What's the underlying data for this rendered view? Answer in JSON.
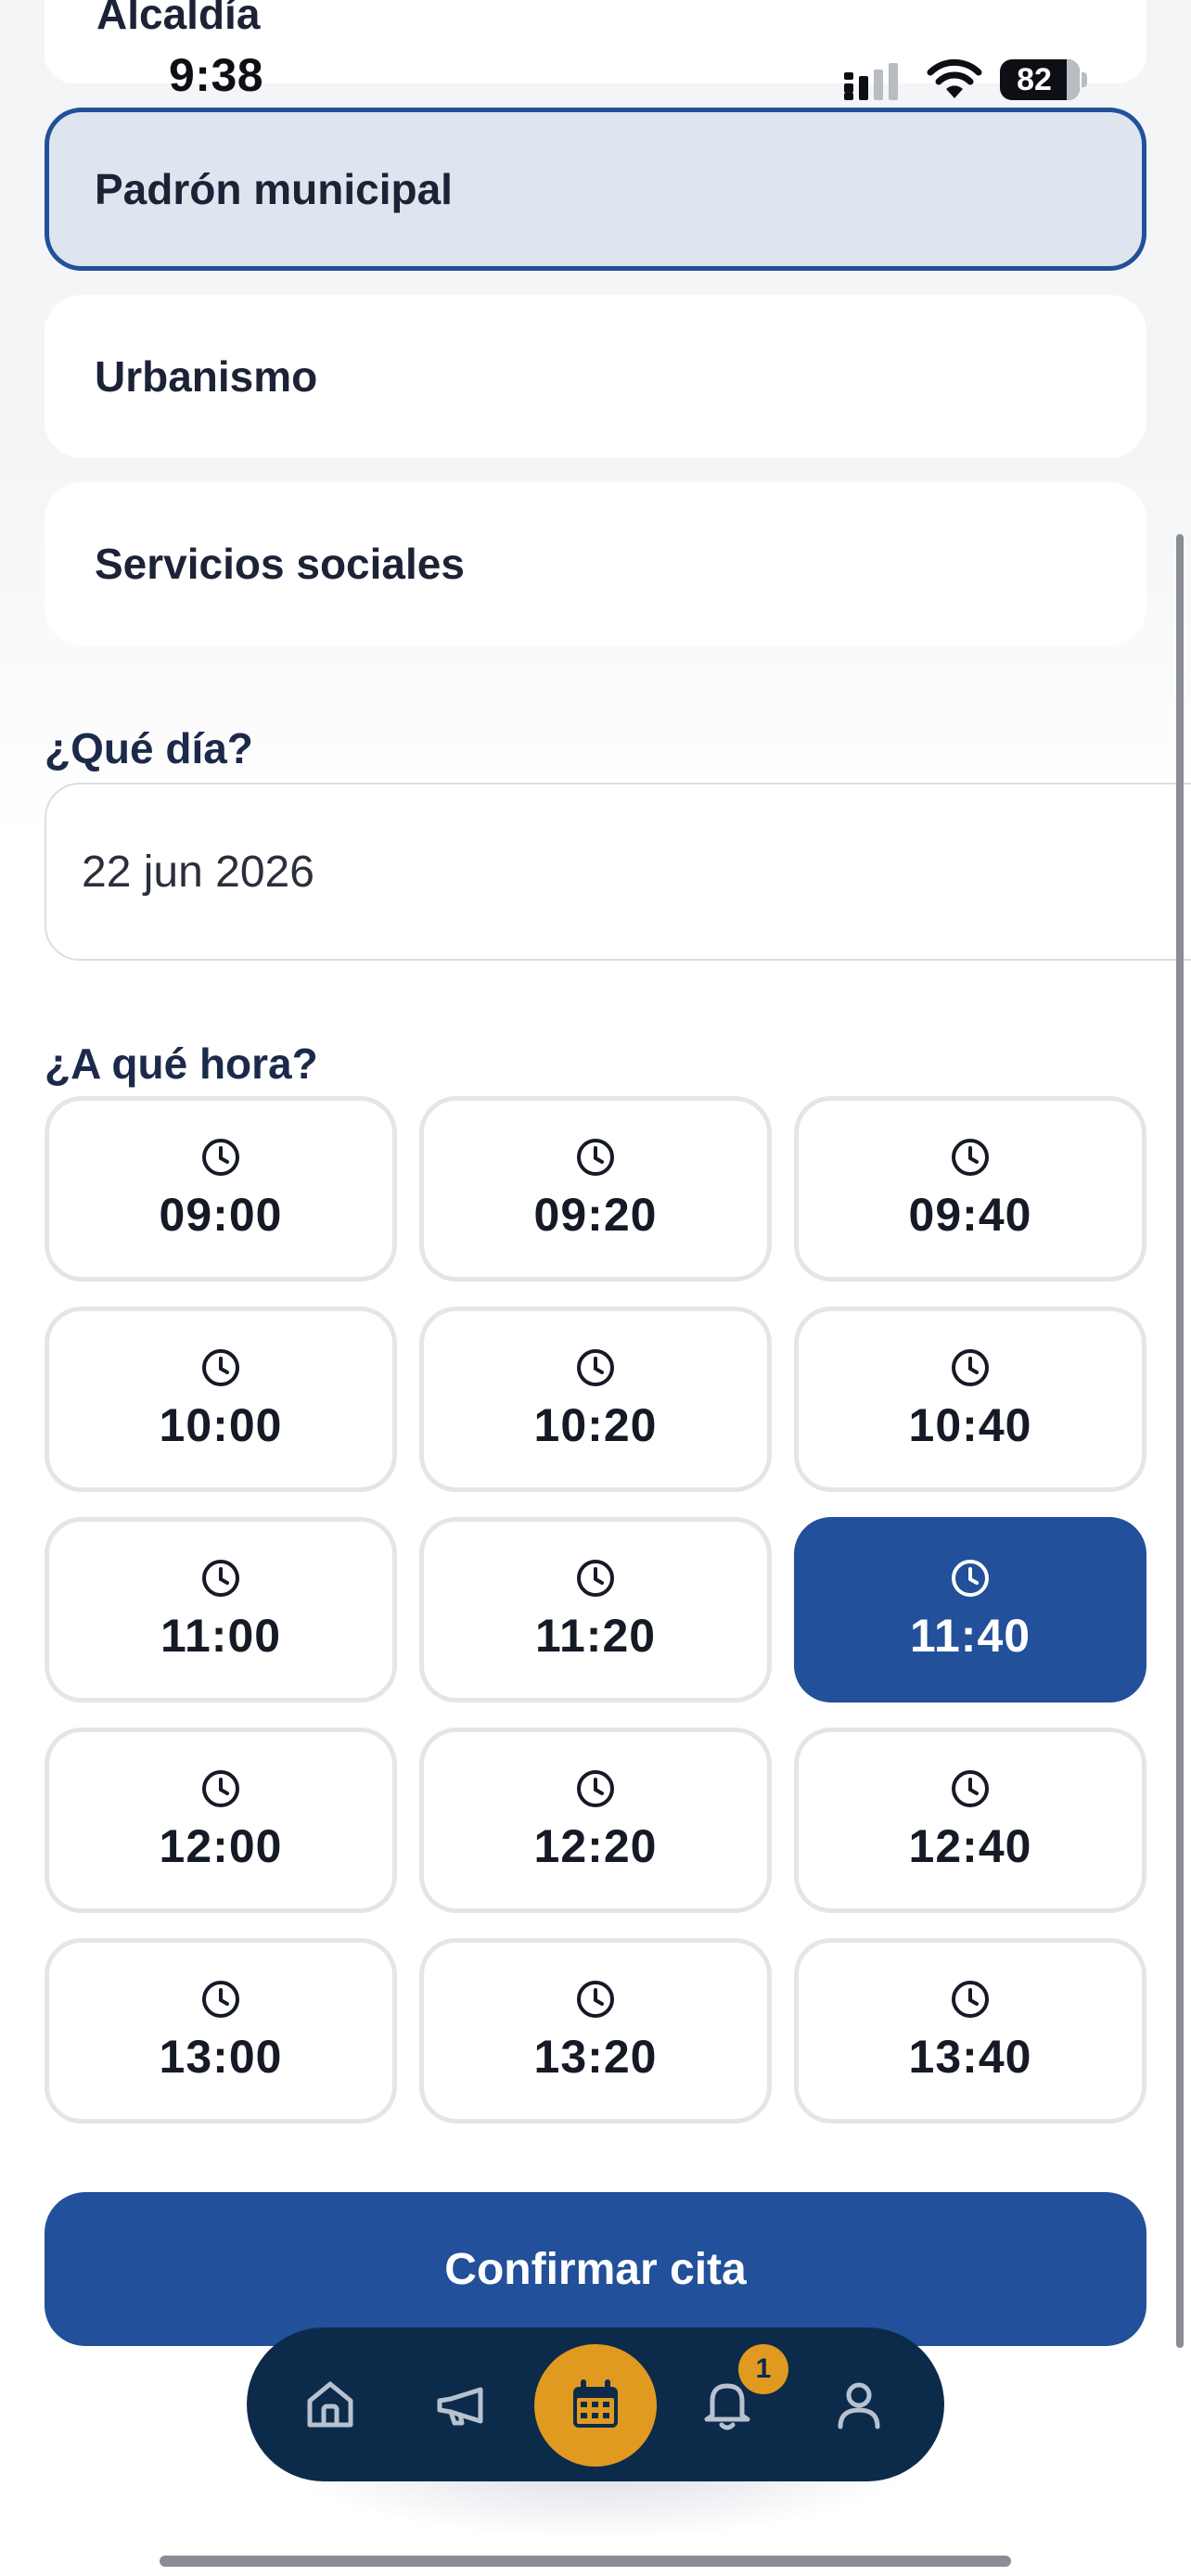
{
  "status_bar": {
    "time": "9:38",
    "battery_level": "82",
    "icons": [
      "cellular-signal-icon",
      "wifi-icon",
      "battery-icon"
    ]
  },
  "departments": {
    "partial_top_label": "Alcaldía",
    "items": [
      {
        "label": "Padrón municipal",
        "selected": true
      },
      {
        "label": "Urbanismo",
        "selected": false
      },
      {
        "label": "Servicios sociales",
        "selected": false
      }
    ]
  },
  "date_section": {
    "label": "¿Qué día?",
    "value": "22 jun 2026"
  },
  "time_section": {
    "label": "¿A qué hora?",
    "selected": "11:40",
    "slots": [
      {
        "time": "09:00"
      },
      {
        "time": "09:20"
      },
      {
        "time": "09:40"
      },
      {
        "time": "10:00"
      },
      {
        "time": "10:20"
      },
      {
        "time": "10:40"
      },
      {
        "time": "11:00"
      },
      {
        "time": "11:20"
      },
      {
        "time": "11:40"
      },
      {
        "time": "12:00"
      },
      {
        "time": "12:20"
      },
      {
        "time": "12:40"
      },
      {
        "time": "13:00"
      },
      {
        "time": "13:20"
      },
      {
        "time": "13:40"
      }
    ]
  },
  "confirm_button": {
    "label": "Confirmar cita"
  },
  "bottom_nav": {
    "items": [
      {
        "icon": "home-icon"
      },
      {
        "icon": "megaphone-icon"
      },
      {
        "icon": "calendar-icon",
        "active": true
      },
      {
        "icon": "bell-icon",
        "badge": "1"
      },
      {
        "icon": "user-icon"
      }
    ]
  },
  "colors": {
    "primary": "#22509a",
    "selected_bg": "#dfe5ee",
    "nav_bg": "#0c2b4b",
    "accent": "#e09a1f"
  }
}
